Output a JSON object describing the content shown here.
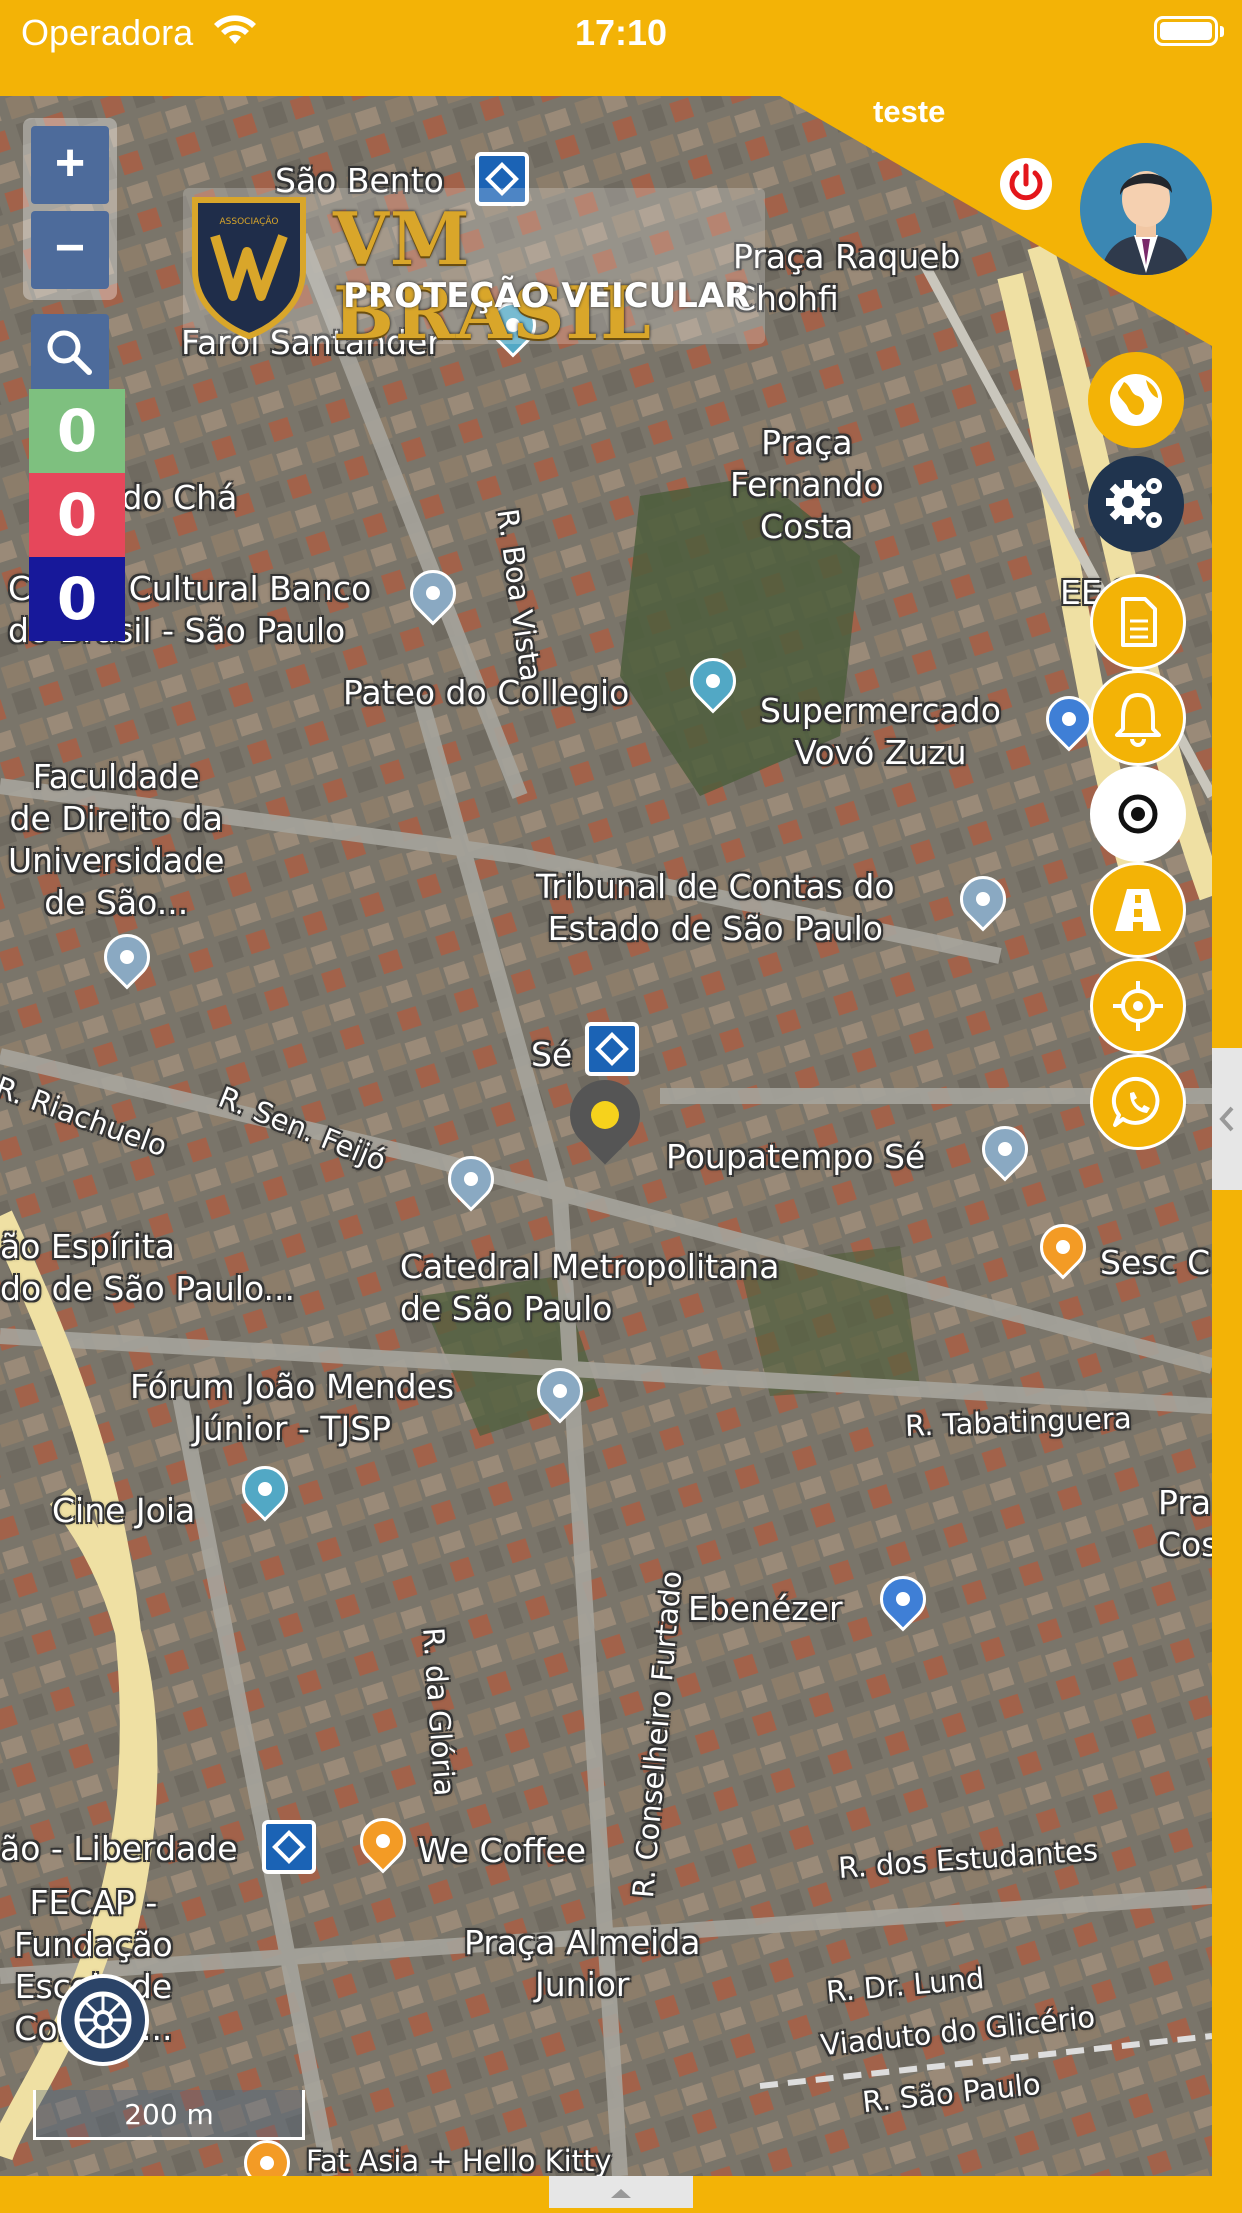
{
  "status_bar": {
    "carrier": "Operadora",
    "time": "17:10"
  },
  "header": {
    "username": "teste"
  },
  "map_controls": {
    "zoom_in": "+",
    "zoom_out": "−"
  },
  "counters": {
    "green": "0",
    "red": "0",
    "blue": "0"
  },
  "logo": {
    "title": "VM BRASIL",
    "subtitle": "PROTEÇÃO VEICULAR",
    "badge_text": "ASSOCIAÇÃO"
  },
  "map_labels": [
    "São Bento",
    "Praça Raqueb\nChohfi",
    "Farol Santander",
    "R. Boa Vista",
    "Praça\nFernando\nCosta",
    "duto do Chá",
    "Centro Cultural Banco\ndo Brasil - São Paulo",
    "EE S",
    "Pateo do Collegio",
    "Supermercado\nVovó Zuzu",
    "Faculdade\nde Direito da\nUniversidade\nde São...",
    "Tribunal de Contas do\nEstado de São Paulo",
    "Sé",
    "R. Riachuelo",
    "R. Sen. Feijó",
    "Poupatempo Sé",
    "Sesc C",
    "ão Espírita\ndo de São Paulo...",
    "Catedral Metropolitana\nde São Paulo",
    "Fórum João Mendes\nJúnior - TJSP",
    "R. Tabatinguera",
    "Cine Joia",
    "R. Conselheiro Furtado",
    "Pra\nCost",
    "Ebenézer",
    "R. da Glória",
    "ão - Liberdade",
    "We Coffee",
    "R. dos Estudantes",
    "FECAP -\nFundação\nEscola de\nComérc...",
    "Praça Almeida\nJunior",
    "R. Dr. Lund",
    "Viaduto do Glicério",
    "R. São Paulo",
    "Fat Asia + Hello Kitty"
  ],
  "scale": {
    "label": "200 m"
  },
  "icons": {
    "wifi": "wifi-icon",
    "battery": "battery-icon",
    "logout": "power-icon",
    "avatar": "user-avatar",
    "search": "search-icon",
    "globe": "globe-icon",
    "settings": "gears-icon",
    "document": "document-icon",
    "bell": "bell-icon",
    "target": "target-icon",
    "road": "road-icon",
    "locate": "crosshair-icon",
    "whatsapp": "whatsapp-icon",
    "wheel": "steering-wheel-icon"
  },
  "colors": {
    "brand_yellow": "#f3b306",
    "counter_green": "#7ec07f",
    "counter_red": "#e6475b",
    "counter_blue": "#17189a",
    "settings_navy": "#20344e"
  }
}
